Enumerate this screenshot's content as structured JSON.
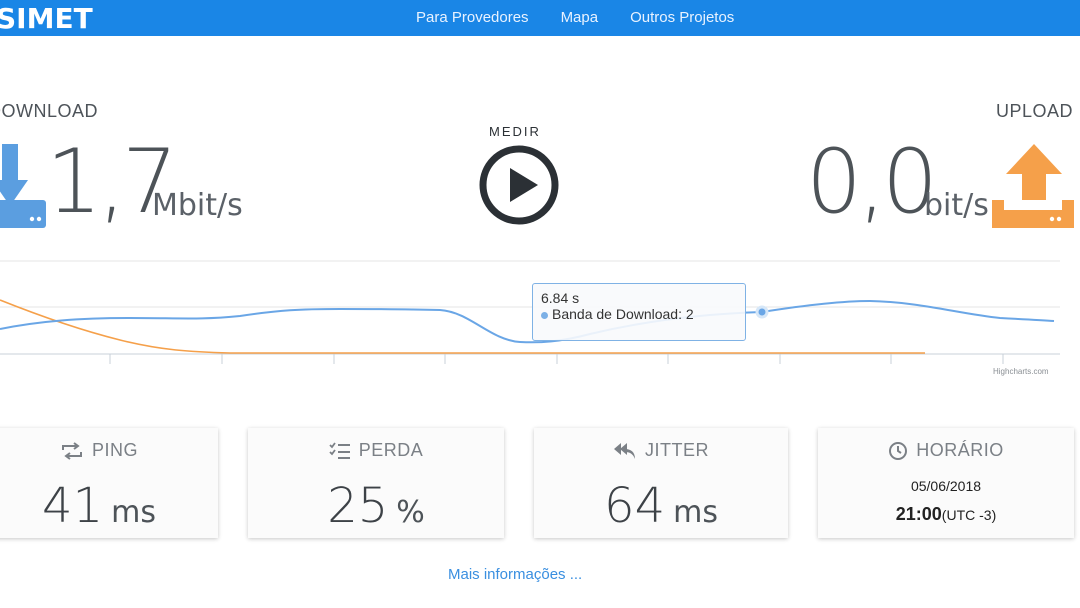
{
  "header": {
    "logo": "SIMET",
    "nav": [
      "Para Provedores",
      "Mapa",
      "Outros Projetos"
    ]
  },
  "download": {
    "label": "DOWNLOAD",
    "value": "1,7",
    "unit": "Mbit/s",
    "icon": "download-icon",
    "color": "#5b9ee0"
  },
  "upload": {
    "label": "UPLOAD",
    "value": "0,0",
    "unit": "bit/s",
    "icon": "upload-icon",
    "color": "#f5a04a"
  },
  "measure": {
    "label": "MEDIR",
    "icon": "play-icon"
  },
  "chart": {
    "credit": "Highcharts.com",
    "tooltip": {
      "time": "6.84 s",
      "series": "Banda de Download",
      "value": "2"
    }
  },
  "stats": [
    {
      "label": "PING",
      "value": "41",
      "unit": "ms",
      "icon": "repeat-icon"
    },
    {
      "label": "PERDA",
      "value": "25",
      "unit": "%",
      "icon": "checklist-icon"
    },
    {
      "label": "JITTER",
      "value": "64",
      "unit": "ms",
      "icon": "reply-all-icon"
    },
    {
      "label": "HORÁRIO",
      "date": "05/06/2018",
      "time": "21:00",
      "tz": "(UTC -3)",
      "icon": "clock-icon"
    }
  ],
  "more_link": "Mais informações ..."
}
